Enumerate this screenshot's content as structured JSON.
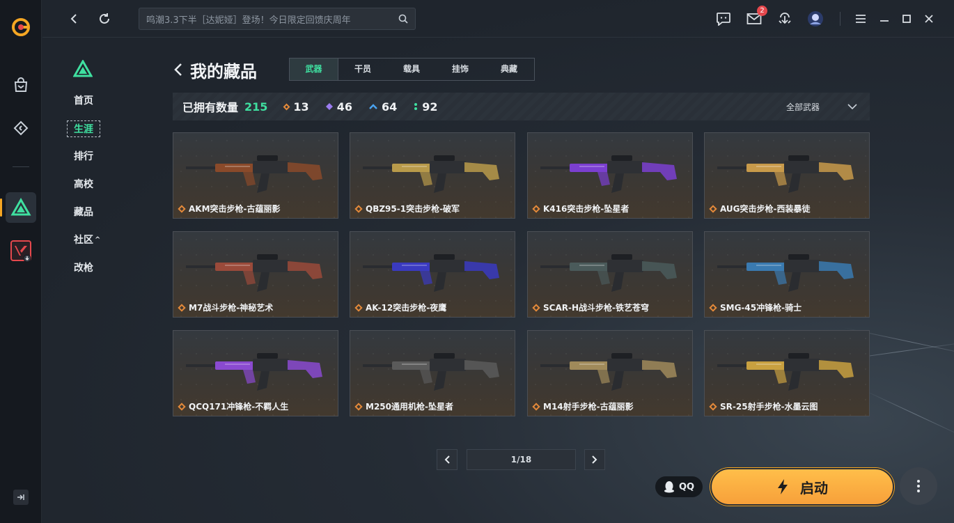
{
  "titlebar": {
    "search_placeholder": "鸣潮3.3下半［达妮娅］登场！今日限定回馈庆周年",
    "mail_badge": "2"
  },
  "nav": {
    "items": [
      {
        "label": "首页",
        "active": false
      },
      {
        "label": "生涯",
        "active": true
      },
      {
        "label": "排行",
        "active": false
      },
      {
        "label": "高校",
        "active": false
      },
      {
        "label": "藏品",
        "active": false
      },
      {
        "label": "社区",
        "active": false,
        "caret": "^"
      },
      {
        "label": "改枪",
        "active": false
      }
    ]
  },
  "page": {
    "title": "我的藏品",
    "tabs": [
      "武器",
      "干员",
      "载具",
      "挂饰",
      "典藏"
    ],
    "active_tab": "武器"
  },
  "summary": {
    "owned_label": "已拥有数量",
    "owned_total": "215",
    "rarity_counts": [
      {
        "icon": "orange-diamond-icon",
        "color": "#e58a3a",
        "count": "13"
      },
      {
        "icon": "purple-diamond-icon",
        "color": "#9b7cf0",
        "count": "46"
      },
      {
        "icon": "blue-chevron-icon",
        "color": "#4aa3f0",
        "count": "64"
      },
      {
        "icon": "green-dots-icon",
        "color": "#3fe0a0",
        "count": "92"
      }
    ],
    "filter_label": "全部武器"
  },
  "weapons": [
    {
      "name": "AKM突击步枪-古蕴丽影",
      "accent": "#8a4a2a"
    },
    {
      "name": "QBZ95-1突击步枪-破军",
      "accent": "#b89a4a"
    },
    {
      "name": "K416突击步枪-坠星者",
      "accent": "#7b3fd0"
    },
    {
      "name": "AUG突击步枪-西装暴徒",
      "accent": "#c89a4a"
    },
    {
      "name": "M7战斗步枪-神秘艺术",
      "accent": "#9a4a3a"
    },
    {
      "name": "AK-12突击步枪-夜鹰",
      "accent": "#3a3ac0"
    },
    {
      "name": "SCAR-H战斗步枪-铁艺苍穹",
      "accent": "#4a5a5a"
    },
    {
      "name": "SMG-45冲锋枪-骑士",
      "accent": "#3a7ab0"
    },
    {
      "name": "QCQ171冲锋枪-不羁人生",
      "accent": "#8a4ad0"
    },
    {
      "name": "M250通用机枪-坠星者",
      "accent": "#5a5a5a"
    },
    {
      "name": "M14射手步枪-古蕴丽影",
      "accent": "#a08a5a"
    },
    {
      "name": "SR-25射手步枪-水墨云图",
      "accent": "#c8a040"
    }
  ],
  "pagination": {
    "current": "1/18"
  },
  "actions": {
    "qq_label": "QQ",
    "launch_label": "启动"
  }
}
